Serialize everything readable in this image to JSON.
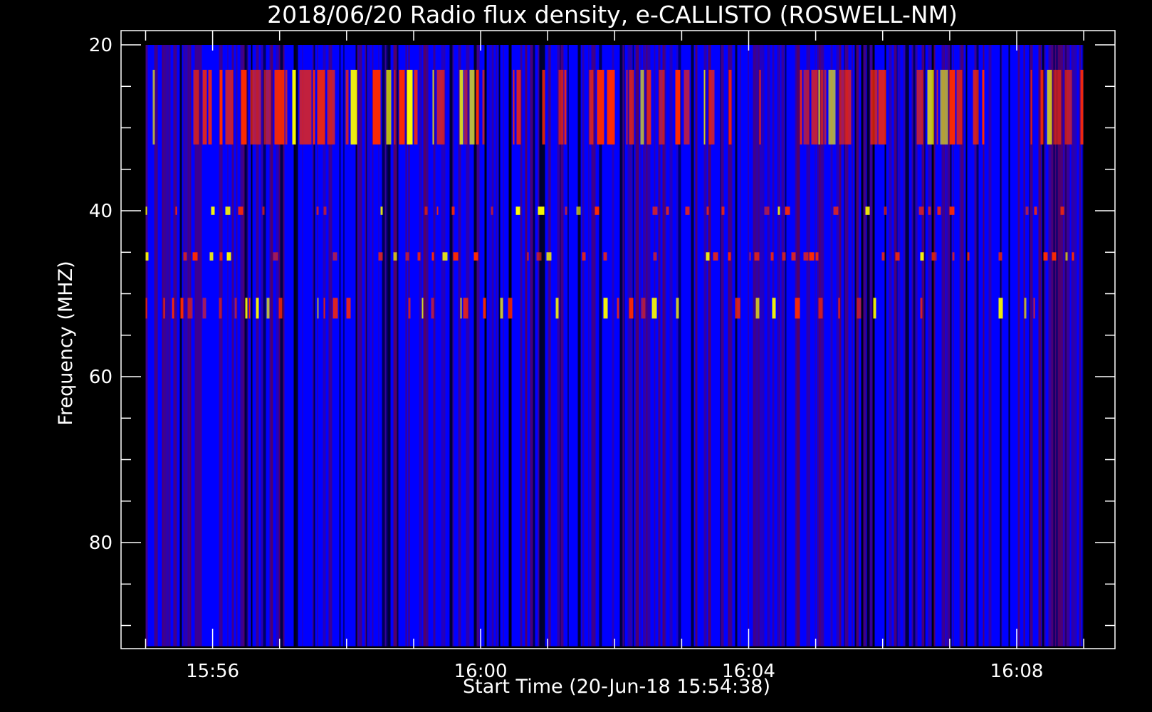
{
  "chart_data": {
    "type": "heatmap",
    "title": "2018/06/20  Radio flux density, e-CALLISTO (ROSWELL-NM)",
    "xlabel": "Start Time (20-Jun-18 15:54:38)",
    "ylabel": "Frequency (MHZ)",
    "x_unit": "time (UT)",
    "xlim": [
      "15:54:38",
      "16:09:28"
    ],
    "ylim": [
      92.5,
      20
    ],
    "x_major_ticks": [
      {
        "t": "15:56",
        "label": "15:56"
      },
      {
        "t": "16:00",
        "label": "16:00"
      },
      {
        "t": "16:04",
        "label": "16:04"
      },
      {
        "t": "16:08",
        "label": "16:08"
      }
    ],
    "y_major_ticks": [
      {
        "v": 20,
        "label": "20"
      },
      {
        "v": 40,
        "label": "40"
      },
      {
        "v": 60,
        "label": "60"
      },
      {
        "v": 80,
        "label": "80"
      }
    ],
    "y_minor_step": 5,
    "x_minor_step_seconds": 60,
    "data_time_range": [
      "15:55:00",
      "16:09:00"
    ],
    "data_freq_range_mhz": [
      20,
      92.5
    ],
    "colormap": [
      "#000000",
      "#0000ff",
      "#8b0000",
      "#ff2a00",
      "#ffff00"
    ],
    "features": [
      {
        "freq_mhz": [
          23,
          32
        ],
        "description": "intermittent strong interference band"
      },
      {
        "freq_mhz": [
          39.5,
          40.5
        ],
        "description": "narrowband line"
      },
      {
        "freq_mhz": [
          45,
          46
        ],
        "description": "narrowband line"
      },
      {
        "freq_mhz": [
          50.5,
          53
        ],
        "description": "narrowband lines"
      }
    ]
  }
}
